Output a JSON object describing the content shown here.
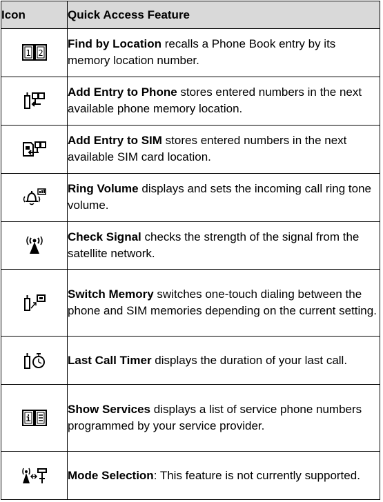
{
  "table": {
    "headers": [
      "Icon",
      "Quick Access Feature"
    ],
    "rows": [
      {
        "icon": "phonebook-location-icon",
        "title": "Find by Location",
        "desc": " recalls a Phone Book entry by its memory location number."
      },
      {
        "icon": "add-entry-phone-icon",
        "title": "Add Entry to Phone",
        "desc": " stores entered numbers in the next available phone memory location."
      },
      {
        "icon": "add-entry-sim-icon",
        "title": "Add Entry to SIM",
        "desc": " stores entered numbers in the next available SIM card location."
      },
      {
        "icon": "ring-volume-icon",
        "title": "Ring Volume",
        "desc": " displays and sets the incoming call ring tone volume."
      },
      {
        "icon": "check-signal-icon",
        "title": "Check Signal",
        "desc": " checks the strength of the signal from the satellite network."
      },
      {
        "icon": "switch-memory-icon",
        "title": "Switch Memory",
        "desc": " switches one-touch dialing between the phone and SIM memories depending on the current setting."
      },
      {
        "icon": "last-call-timer-icon",
        "title": "Last Call Timer",
        "desc": " displays the duration of your last call."
      },
      {
        "icon": "show-services-icon",
        "title": "Show Services",
        "desc": " displays a list of service phone numbers programmed by your service provider."
      },
      {
        "icon": "mode-selection-icon",
        "title": "Mode Selection",
        "desc": ": This feature is not currently supported."
      }
    ]
  }
}
